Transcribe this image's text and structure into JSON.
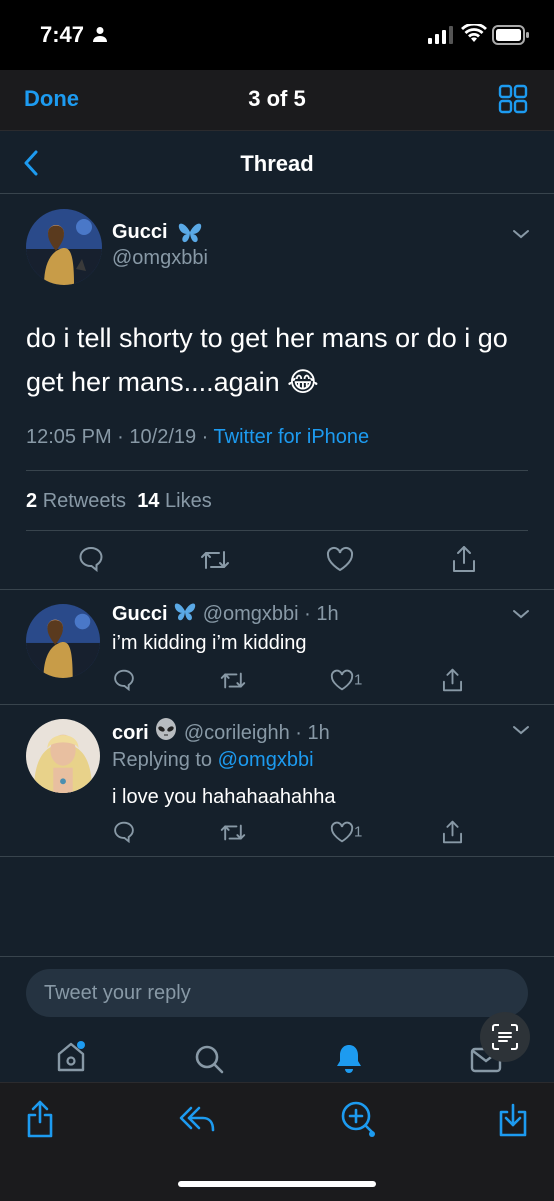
{
  "status_bar": {
    "time": "7:47"
  },
  "quicklook": {
    "done_label": "Done",
    "page_count": "3 of 5"
  },
  "nav": {
    "title": "Thread"
  },
  "main_tweet": {
    "name": "Gucci",
    "handle": "@omgxbbi",
    "text": "do i tell shorty to get her mans or do i go get her mans....again 😂",
    "time": "12:05 PM",
    "date": "10/2/19",
    "source": "Twitter for iPhone",
    "retweets_count": "2",
    "retweets_label": "Retweets",
    "likes_count": "14",
    "likes_label": "Likes"
  },
  "replies": [
    {
      "name": "Gucci",
      "handle": "@omgxbbi",
      "age": "1h",
      "text": "i’m kidding i’m kidding",
      "likes": "1"
    },
    {
      "name": "cori",
      "handle": "@corileighh",
      "age": "1h",
      "replying_to_label": "Replying to",
      "replying_to_handle": "@omgxbbi",
      "text": "i love you hahahaahahha",
      "likes": "1"
    }
  ],
  "composer": {
    "placeholder": "Tweet your reply"
  },
  "colors": {
    "accent": "#1d9bf0",
    "background": "#15202b",
    "muted": "#8899a6",
    "divider": "#38444d"
  },
  "icons": {
    "status": [
      "person-icon",
      "signal-icon",
      "wifi-icon",
      "battery-icon"
    ],
    "tabs": [
      "home-icon",
      "search-icon",
      "notifications-icon",
      "messages-icon"
    ],
    "toolbar": [
      "share-icon",
      "reply-arrow-icon",
      "zoom-add-icon",
      "save-icon"
    ]
  }
}
